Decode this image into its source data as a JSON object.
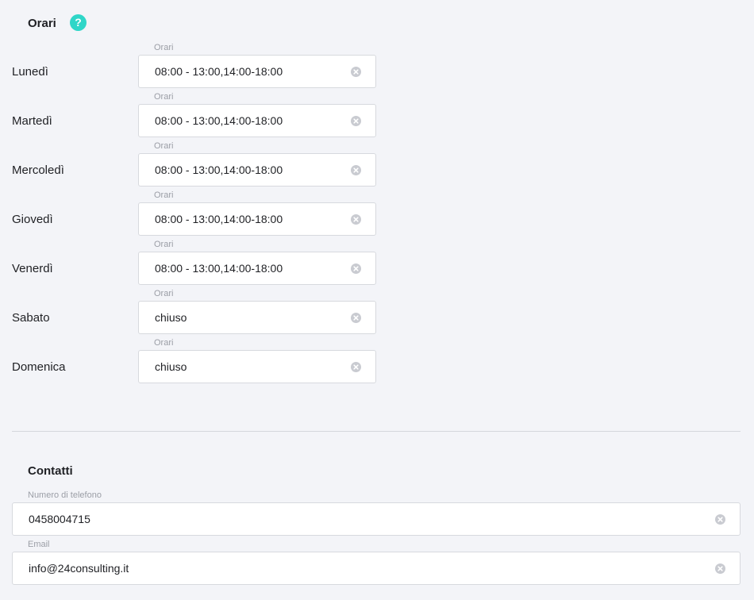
{
  "hours": {
    "title": "Orari",
    "help_icon": "question-circle-icon",
    "help_glyph": "?",
    "days": [
      {
        "label": "Lunedì",
        "caption": "Orari",
        "value": "08:00 - 13:00,14:00-18:00"
      },
      {
        "label": "Martedì",
        "caption": "Orari",
        "value": "08:00 - 13:00,14:00-18:00"
      },
      {
        "label": "Mercoledì",
        "caption": "Orari",
        "value": "08:00 - 13:00,14:00-18:00"
      },
      {
        "label": "Giovedì",
        "caption": "Orari",
        "value": "08:00 - 13:00,14:00-18:00"
      },
      {
        "label": "Venerdì",
        "caption": "Orari",
        "value": "08:00 - 13:00,14:00-18:00"
      },
      {
        "label": "Sabato",
        "caption": "Orari",
        "value": "chiuso"
      },
      {
        "label": "Domenica",
        "caption": "Orari",
        "value": "chiuso"
      }
    ]
  },
  "contacts": {
    "title": "Contatti",
    "phone": {
      "caption": "Numero di telefono",
      "value": "0458004715"
    },
    "email": {
      "caption": "Email",
      "value": "info@24consulting.it"
    }
  },
  "colors": {
    "accent": "#2fd6c8",
    "background": "#f3f4f8",
    "clear_icon": "#c9cbd1"
  },
  "icons": {
    "clear": "clear-circle-icon"
  }
}
